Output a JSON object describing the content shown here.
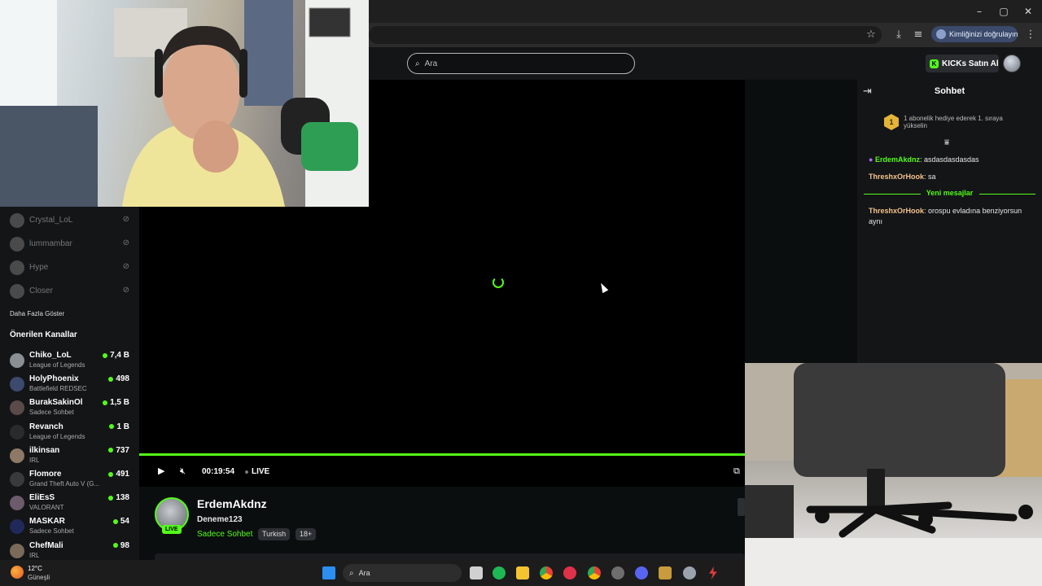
{
  "browser": {
    "profile_label": "Kimliğinizi doğrulayın",
    "icons": [
      "minimize-icon",
      "maximize-icon",
      "close-icon",
      "star-icon",
      "download-icon",
      "media-icon",
      "menu-icon"
    ]
  },
  "header": {
    "search_placeholder": "Ara",
    "buy_kicks_label": "KICKs Satın Al"
  },
  "sidebar": {
    "offline_channels": [
      {
        "name": "Crystal_LoL"
      },
      {
        "name": "lummambar"
      },
      {
        "name": "Hype"
      },
      {
        "name": "Closer"
      }
    ],
    "show_more_label": "Daha Fazla Göster",
    "recommended_title": "Önerilen Kanallar",
    "recommended": [
      {
        "name": "Chiko_LoL",
        "category": "League of Legends",
        "viewers": "7,4 B"
      },
      {
        "name": "HolyPhoenix",
        "category": "Battlefield REDSEC",
        "viewers": "498"
      },
      {
        "name": "BurakSakinOl",
        "category": "Sadece Sohbet",
        "viewers": "1,5 B"
      },
      {
        "name": "Revanch",
        "category": "League of Legends",
        "viewers": "1 B"
      },
      {
        "name": "ilkinsan",
        "category": "IRL",
        "viewers": "737"
      },
      {
        "name": "Flomore",
        "category": "Grand Theft Auto V (G...",
        "viewers": "491"
      },
      {
        "name": "EliEsS",
        "category": "VALORANT",
        "viewers": "138"
      },
      {
        "name": "MASKAR",
        "category": "Sadece Sohbet",
        "viewers": "54"
      },
      {
        "name": "ChefMali",
        "category": "IRL",
        "viewers": "98"
      }
    ]
  },
  "player": {
    "timer": "00:19:54",
    "live_label": "LIVE",
    "progress": 1.0
  },
  "channel": {
    "name": "ErdemAkdnz",
    "live_badge": "LIVE",
    "title": "Deneme123",
    "category": "Sadece Sohbet",
    "tags": [
      "Turkish",
      "18+"
    ]
  },
  "chat": {
    "title": "Sohbet",
    "gift_rank": "1",
    "gift_text": "1 abonelik hediye ederek 1. sıraya yükselin",
    "messages_before": [
      {
        "user": "ErdemAkdnz",
        "text": "asdasdasdasdas",
        "color": "#53fc18"
      },
      {
        "user": "ThreshxOrHook",
        "text": "sa",
        "color": "#f5c38b"
      }
    ],
    "new_messages_label": "Yeni mesajlar",
    "messages_after": [
      {
        "user": "ThreshxOrHook",
        "text": "orospu evladına benziyorsun aynı",
        "color": "#f5c38b"
      }
    ]
  },
  "taskbar": {
    "temperature": "12°C",
    "condition": "Güneşli",
    "search_placeholder": "Ara",
    "apps": [
      "windows-start-icon",
      "task-view-icon",
      "spotify-icon",
      "file-explorer-icon",
      "chrome-icon",
      "app-red-icon",
      "chrome-active-icon",
      "app-badge-icon",
      "discord-icon",
      "league-client-icon",
      "settings-icon",
      "lightning-app-icon"
    ]
  }
}
